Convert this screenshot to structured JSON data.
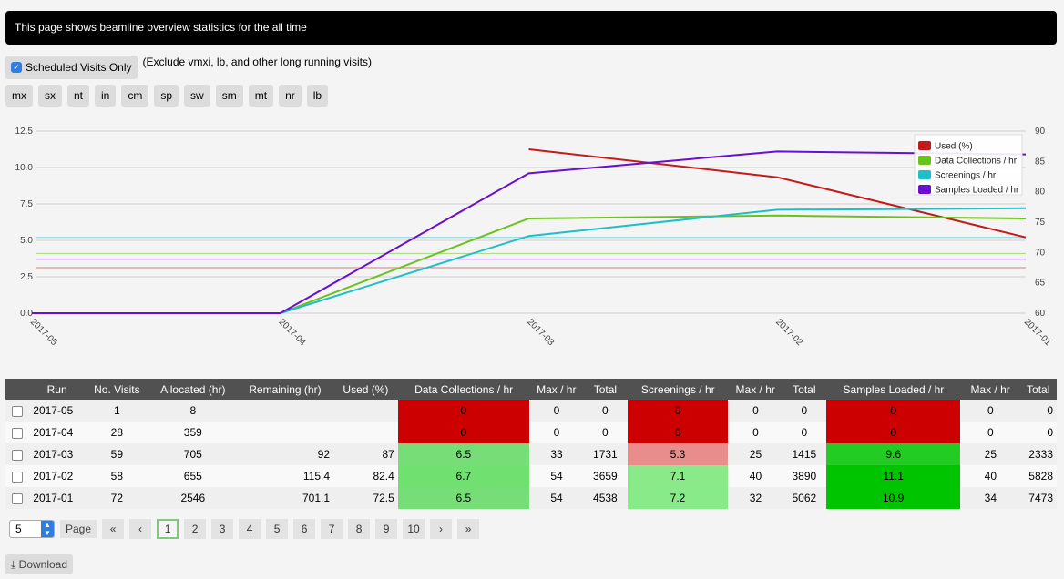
{
  "banner": {
    "text": "This page shows beamline overview statistics for the all time"
  },
  "options": {
    "scheduled_label": "Scheduled Visits Only",
    "scheduled_checked": true,
    "exclude_note": "(Exclude vmxi, lb, and other long running visits)"
  },
  "beamlines": [
    "mx",
    "sx",
    "nt",
    "in",
    "cm",
    "sp",
    "sw",
    "sm",
    "mt",
    "nr",
    "lb"
  ],
  "chart_data": {
    "type": "line",
    "x": [
      "2017-05",
      "2017-04",
      "2017-03",
      "2017-02",
      "2017-01"
    ],
    "left_axis": {
      "ylim": [
        0,
        12.5
      ],
      "ticks": [
        "0.0",
        "2.5",
        "5.0",
        "7.5",
        "10.0",
        "12.5"
      ]
    },
    "right_axis": {
      "ylim": [
        60,
        90
      ],
      "ticks": [
        "60",
        "65",
        "70",
        "75",
        "80",
        "85",
        "90"
      ]
    },
    "series": [
      {
        "name": "Used (%)",
        "color": "#c41a1a",
        "axis": "right",
        "values": [
          null,
          null,
          87,
          82.4,
          72.5
        ]
      },
      {
        "name": "Data Collections / hr",
        "color": "#6cc21d",
        "axis": "left",
        "values": [
          0,
          0,
          6.5,
          6.7,
          6.5
        ]
      },
      {
        "name": "Screenings / hr",
        "color": "#1fbfc8",
        "axis": "left",
        "values": [
          0,
          0,
          5.3,
          7.1,
          7.2
        ]
      },
      {
        "name": "Samples Loaded / hr",
        "color": "#6a0fd0",
        "axis": "left",
        "values": [
          0,
          0,
          9.6,
          11.1,
          10.9
        ]
      }
    ],
    "average_lines": [
      {
        "series": "Used (%)",
        "axis": "right",
        "value": 67.5
      },
      {
        "series": "Data Collections / hr",
        "axis": "left",
        "value": 4.1
      },
      {
        "series": "Screenings / hr",
        "axis": "left",
        "value": 5.2
      },
      {
        "series": "Samples Loaded / hr",
        "axis": "left",
        "value": 3.7
      }
    ],
    "legend_position": "top-right",
    "grid": true
  },
  "table": {
    "headers": [
      "Run",
      "No. Visits",
      "Allocated (hr)",
      "Remaining (hr)",
      "Used (%)",
      "Data Collections / hr",
      "Max / hr",
      "Total",
      "Screenings / hr",
      "Max / hr",
      "Total",
      "Samples Loaded / hr",
      "Max / hr",
      "Total"
    ],
    "rows": [
      {
        "run": "2017-05",
        "visits": "1",
        "allocated": "8",
        "remaining": "",
        "used": "",
        "dc": "0",
        "dc_max": "0",
        "dc_total": "0",
        "scr": "0",
        "scr_max": "0",
        "scr_total": "0",
        "sl": "0",
        "sl_max": "0",
        "sl_total": "0",
        "dc_color": "#cc0000",
        "scr_color": "#cc0000",
        "sl_color": "#cc0000"
      },
      {
        "run": "2017-04",
        "visits": "28",
        "allocated": "359",
        "remaining": "",
        "used": "",
        "dc": "0",
        "dc_max": "0",
        "dc_total": "0",
        "scr": "0",
        "scr_max": "0",
        "scr_total": "0",
        "sl": "0",
        "sl_max": "0",
        "sl_total": "0",
        "dc_color": "#cc0000",
        "scr_color": "#cc0000",
        "sl_color": "#cc0000"
      },
      {
        "run": "2017-03",
        "visits": "59",
        "allocated": "705",
        "remaining": "92",
        "used": "87",
        "dc": "6.5",
        "dc_max": "33",
        "dc_total": "1731",
        "scr": "5.3",
        "scr_max": "25",
        "scr_total": "1415",
        "sl": "9.6",
        "sl_max": "25",
        "sl_total": "2333",
        "dc_color": "#77dd77",
        "scr_color": "#e88c8c",
        "sl_color": "#22cc22"
      },
      {
        "run": "2017-02",
        "visits": "58",
        "allocated": "655",
        "remaining": "115.4",
        "used": "82.4",
        "dc": "6.7",
        "dc_max": "54",
        "dc_total": "3659",
        "scr": "7.1",
        "scr_max": "40",
        "scr_total": "3890",
        "sl": "11.1",
        "sl_max": "40",
        "sl_total": "5828",
        "dc_color": "#70e070",
        "scr_color": "#8aea8a",
        "sl_color": "#00c400"
      },
      {
        "run": "2017-01",
        "visits": "72",
        "allocated": "2546",
        "remaining": "701.1",
        "used": "72.5",
        "dc": "6.5",
        "dc_max": "54",
        "dc_total": "4538",
        "scr": "7.2",
        "scr_max": "32",
        "scr_total": "5062",
        "sl": "10.9",
        "sl_max": "34",
        "sl_total": "7473",
        "dc_color": "#77dd77",
        "scr_color": "#88ea88",
        "sl_color": "#00c400"
      }
    ]
  },
  "pagination": {
    "page_size": "5",
    "page_label": "Page",
    "first": "«",
    "prev": "‹",
    "pages": [
      "1",
      "2",
      "3",
      "4",
      "5",
      "6",
      "7",
      "8",
      "9",
      "10"
    ],
    "current": "1",
    "next": "›",
    "last": "»"
  },
  "download": {
    "label": "Download"
  }
}
